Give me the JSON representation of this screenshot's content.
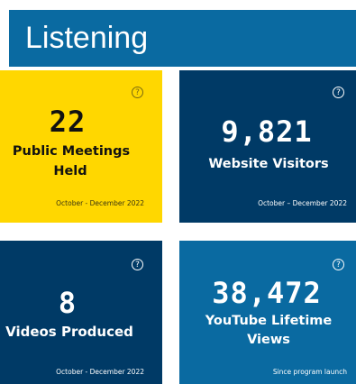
{
  "header": {
    "title": "Listening"
  },
  "colors": {
    "header_bg": "#0a6aa1",
    "tile_yellow": "#ffd700",
    "tile_navy": "#003a66",
    "tile_blue": "#0a6aa1",
    "text_dark": "#111111",
    "text_light": "#ffffff"
  },
  "tiles": [
    {
      "help_icon": "question-mark-circle-icon",
      "help_label": "?",
      "value": "22",
      "label_line1": "Public Meetings",
      "label_line2": "Held",
      "period": "October - December 2022"
    },
    {
      "help_icon": "question-mark-circle-icon",
      "help_label": "?",
      "value": "9,821",
      "label_line1": "Website Visitors",
      "label_line2": "",
      "period": "October – December 2022"
    },
    {
      "help_icon": "question-mark-circle-icon",
      "help_label": "?",
      "value": "8",
      "label_line1": "Videos Produced",
      "label_line2": "",
      "period": "October - December 2022"
    },
    {
      "help_icon": "question-mark-circle-icon",
      "help_label": "?",
      "value": "38,472",
      "label_line1": "YouTube Lifetime",
      "label_line2": "Views",
      "period": "Since program launch"
    }
  ]
}
